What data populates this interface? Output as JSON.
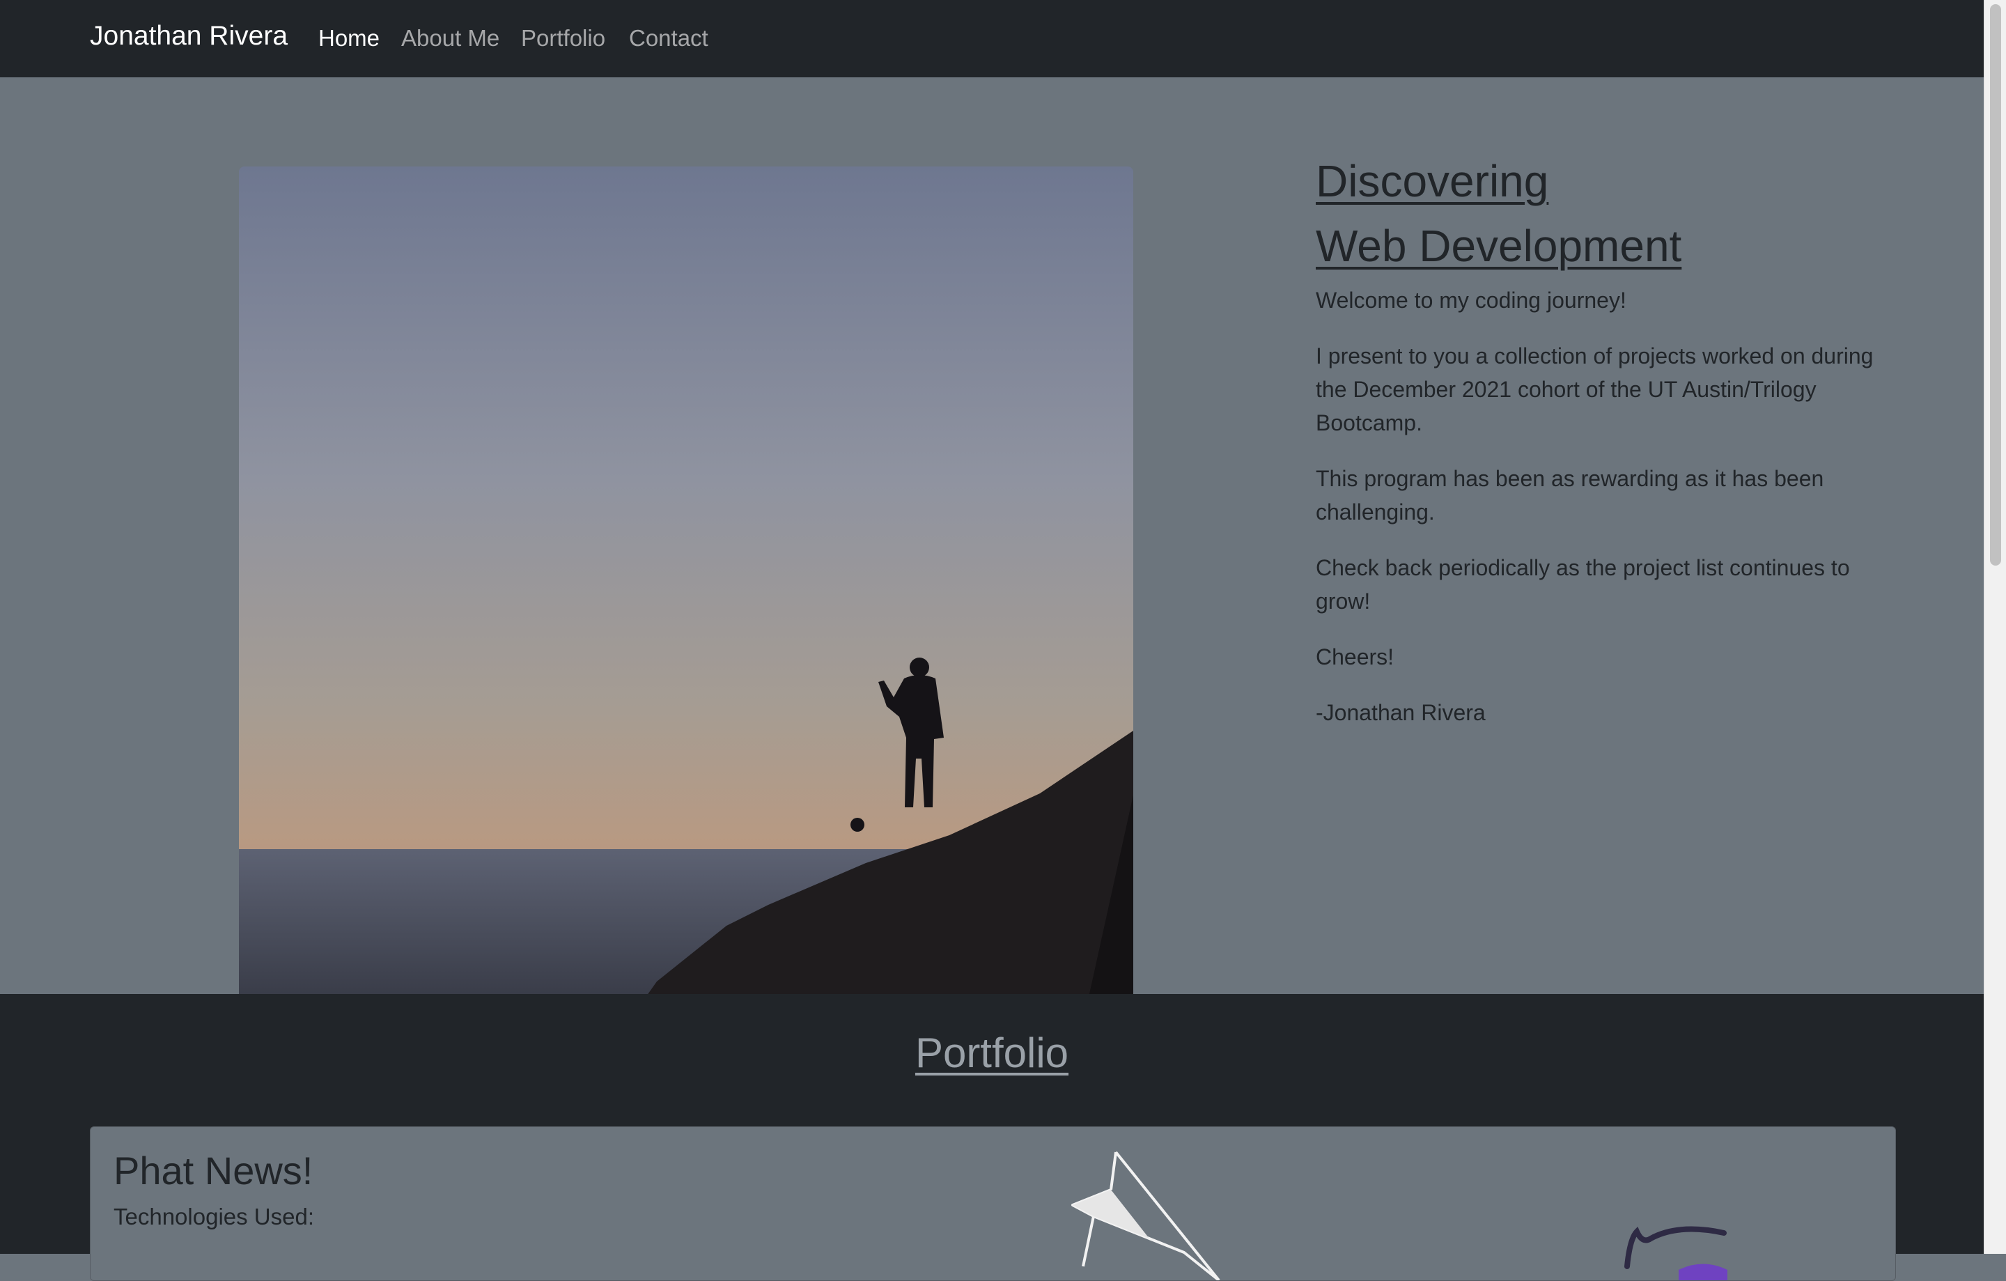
{
  "navbar": {
    "brand": "Jonathan Rivera",
    "links": [
      {
        "label": "Home",
        "active": true
      },
      {
        "label": "About Me",
        "active": false
      },
      {
        "label": "Portfolio",
        "active": false
      },
      {
        "label": "Contact",
        "active": false
      }
    ]
  },
  "hero": {
    "title_line1": "Discovering",
    "title_line2": "Web Development",
    "paragraphs": [
      "Welcome to my coding journey!",
      "I present to you a collection of projects worked on during the December 2021 cohort of the UT Austin/Trilogy Bootcamp.",
      "This program has been as rewarding as it has been challenging.",
      "Check back periodically as the project list continues to grow!",
      "Cheers!",
      "-Jonathan Rivera"
    ]
  },
  "portfolio": {
    "heading": "Portfolio",
    "card": {
      "title": "Phat News!",
      "subtitle": "Technologies Used:"
    }
  },
  "colors": {
    "navbar_bg": "#212529",
    "page_bg": "#6c757d",
    "text_dark": "#212529",
    "accent_purple": "#6f42c1"
  }
}
